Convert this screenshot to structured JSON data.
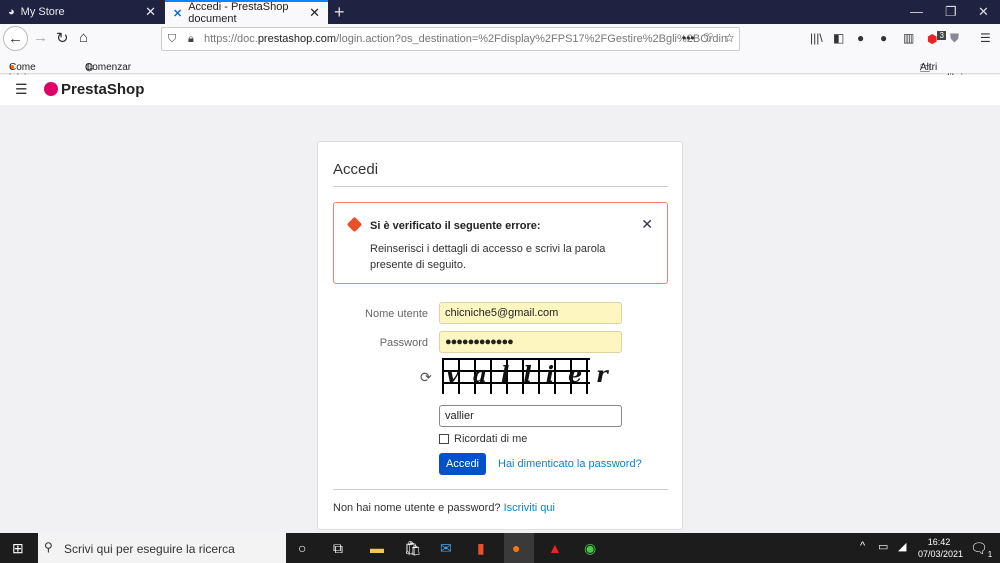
{
  "browser": {
    "tabs": [
      {
        "label": "My Store"
      },
      {
        "label": "Accedi - PrestaShop document",
        "active": true
      }
    ],
    "url_prefix": "https://doc.",
    "url_domain": "prestashop.com",
    "url_rest": "/login.action?os_destination=%2Fdisplay%2FPS17%2FGestire%2Bgli%2BOrdin",
    "bookmarks": [
      "Come iniziare",
      "Comenzar a usar Firefox"
    ],
    "other_bookmarks": "Altri segnalibri",
    "badge_count": "3"
  },
  "header": {
    "logo": "PrestaShop"
  },
  "login": {
    "title": "Accedi",
    "error_title": "Si è verificato il seguente errore:",
    "error_message": "Reinserisci i dettagli di accesso e scrivi la parola presente di seguito.",
    "username_label": "Nome utente",
    "username_value": "chicniche5@gmail.com",
    "password_label": "Password",
    "password_value": "●●●●●●●●●●●●",
    "captcha_text": "vallier",
    "captcha_value": "vallier",
    "remember_label": "Ricordati di me",
    "submit_label": "Accedi",
    "forgot_link": "Hai dimenticato la password?",
    "signup_text": "Non hai nome utente e password?",
    "signup_link": "Iscriviti qui"
  },
  "taskbar": {
    "search_placeholder": "Scrivi qui per eseguire la ricerca",
    "time": "16:42",
    "date": "07/03/2021",
    "notif_count": "1"
  }
}
